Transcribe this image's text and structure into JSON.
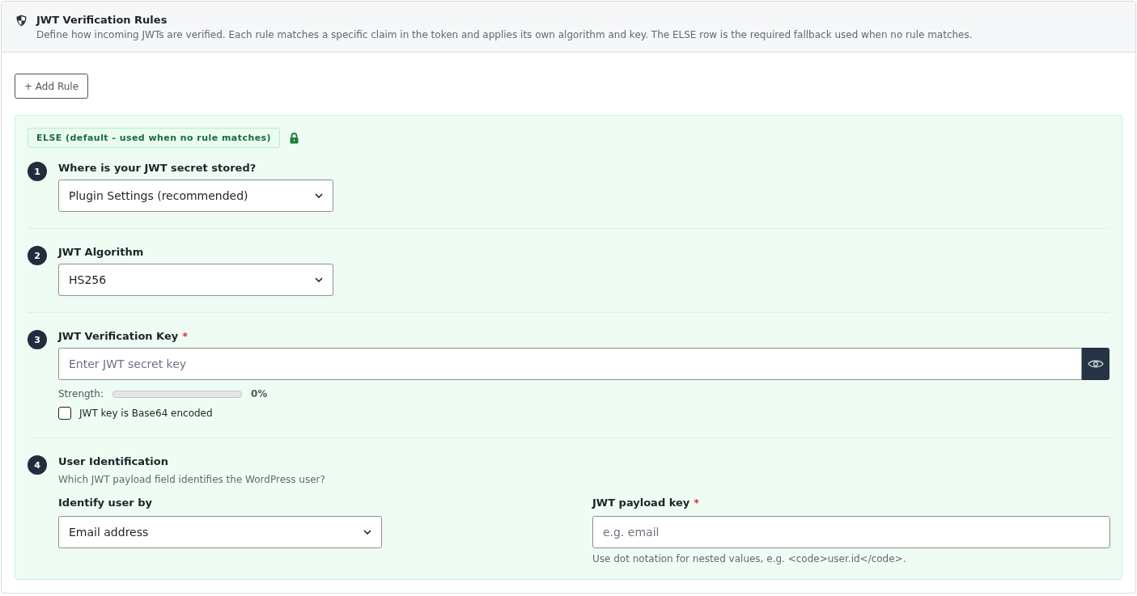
{
  "header": {
    "title": "JWT Verification Rules",
    "description": "Define how incoming JWTs are verified. Each rule matches a specific claim in the token and applies its own algorithm and key. The ELSE row is the required fallback used when no rule matches."
  },
  "add_rule_button": {
    "label": "+ Add Rule"
  },
  "rule": {
    "badge": "ELSE (default - used when no rule matches)",
    "locked": true,
    "steps": [
      {
        "kind": "select",
        "number": "1",
        "label": "Where is your JWT secret stored?",
        "value": "Plugin Settings (recommended)"
      },
      {
        "kind": "select",
        "number": "2",
        "label": "JWT Algorithm",
        "value": "HS256"
      },
      {
        "kind": "secret",
        "number": "3",
        "label": "JWT Verification Key",
        "required_mark": "*",
        "placeholder": "Enter JWT secret key",
        "strength": {
          "label": "Strength:",
          "level": 0,
          "reading": "0%"
        },
        "checkbox": {
          "label": "JWT key is Base64 encoded",
          "checked": false
        }
      },
      {
        "kind": "user",
        "number": "4",
        "label": "User Identification",
        "description": "Which JWT payload field identifies the WordPress user?",
        "fields": [
          {
            "kind": "select",
            "label": "Identify user by",
            "value": "Email address"
          },
          {
            "kind": "input",
            "label": "JWT payload key",
            "required_mark": "*",
            "placeholder": "e.g. email",
            "help": "Use dot notation for nested values, e.g. <code>user.id</code>."
          }
        ]
      }
    ]
  }
}
